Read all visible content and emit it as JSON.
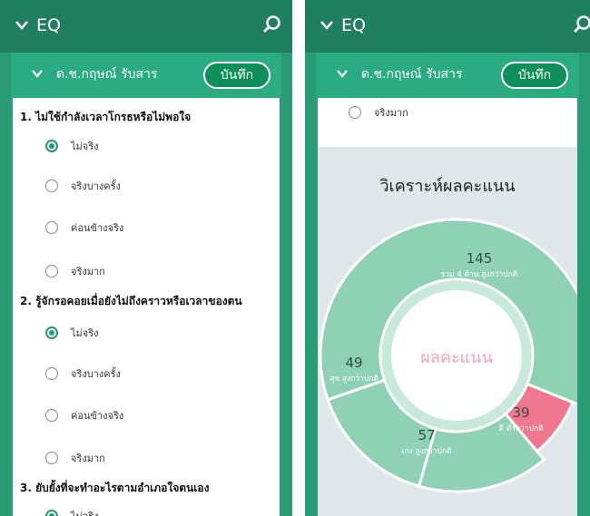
{
  "app_title": "EQ",
  "user_name": "ด.ช.กฤษณ์ รับสาร",
  "save_label": "บันทึก",
  "left_screen": {
    "questions": [
      {
        "text": "1. ไม่ใช้กำลังเวลาโกรธหรือไม่พอใจ",
        "options": [
          "ไม่จริง",
          "จริงบางครั้ง",
          "ค่อนข้างจริง",
          "จริงมาก"
        ],
        "selected": 0
      },
      {
        "text": "2. รู้จักรอคอยเมื่อยังไม่ถึงคราวหรือเวลาของตน",
        "options": [
          "ไม่จริง",
          "จริงบางครั้ง",
          "ค่อนข้างจริง",
          "จริงมาก"
        ],
        "selected": 0
      },
      {
        "text": "3. ยับยั้งที่จะทำอะไรตามอำเภอใจตนเอง",
        "options": [
          "ไม่จริง"
        ],
        "selected": 0
      }
    ]
  },
  "right_screen": {
    "last_option": "จริงมาก",
    "analysis_title": "วิเคราะห์ผลคะแนน",
    "center_label": "ผลคะแนน"
  },
  "colors": {
    "appbar": "#1f7f5f",
    "subbar": "#2aab82",
    "accent_green": "#1f9f6f",
    "segment_green": "#8fd1b5",
    "segment_red": "#f0788e"
  },
  "chart_data": {
    "type": "pie",
    "title": "วิเคราะห์ผลคะแนน",
    "center_label": "ผลคะแนน",
    "segments": [
      {
        "value": "145",
        "label": "รวม 4 ด้าน สูงกว่าปกติ",
        "color": "#8fd1b5"
      },
      {
        "value": "49",
        "label": "สุข สูงกว่าปกติ",
        "color": "#8fd1b5"
      },
      {
        "value": "57",
        "label": "เก่ง สูงกว่าปกติ",
        "color": "#8fd1b5"
      },
      {
        "value": "39",
        "label": "ดี ต่ำกว่าปกติ",
        "color": "#f0788e"
      }
    ]
  }
}
